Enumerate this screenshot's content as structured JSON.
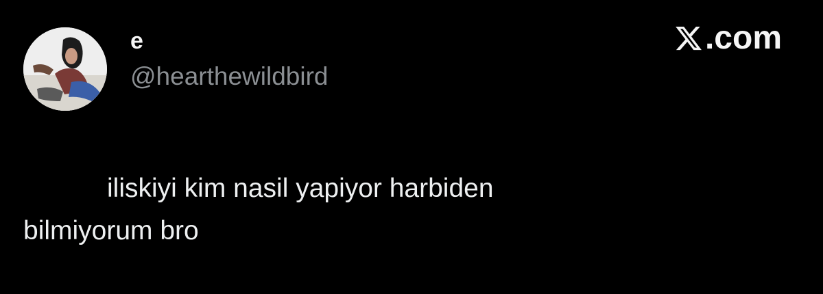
{
  "author": {
    "display_name": "e",
    "handle": "@hearthewildbird"
  },
  "brand": {
    "label": ".com",
    "logo_icon": "x-logo-icon"
  },
  "tweet": {
    "text_line1": "iliskiyi kim nasil yapiyor harbiden",
    "text_line2": "bilmiyorum bro"
  },
  "colors": {
    "background": "#000000",
    "handle": "#8b8f93",
    "text": "#eef0f1"
  }
}
